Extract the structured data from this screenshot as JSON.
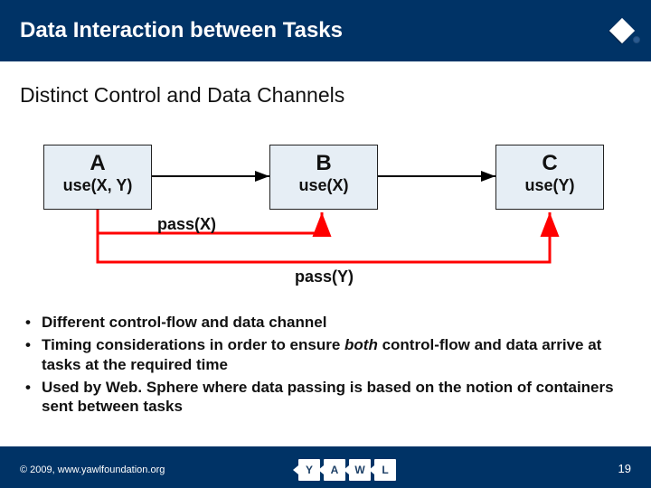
{
  "colors": {
    "brand": "#003366",
    "task_fill": "#e6eef5",
    "pass_stroke": "#ff0000"
  },
  "title": "Data Interaction between Tasks",
  "subtitle": "Distinct Control and Data Channels",
  "diagram": {
    "tasks": [
      {
        "name": "A",
        "use": "use(X, Y)"
      },
      {
        "name": "B",
        "use": "use(X)"
      },
      {
        "name": "C",
        "use": "use(Y)"
      }
    ],
    "edges": [
      {
        "label": "pass(X)"
      },
      {
        "label": "pass(Y)"
      }
    ]
  },
  "bullets": [
    {
      "text_before": "Different control-flow and data channel",
      "emph": "",
      "text_after": ""
    },
    {
      "text_before": "Timing considerations in order to ensure ",
      "emph": "both",
      "text_after": " control-flow and data arrive at tasks at the required time"
    },
    {
      "text_before": "Used by Web. Sphere where data passing is based on the notion of containers sent between tasks",
      "emph": "",
      "text_after": ""
    }
  ],
  "footer": {
    "copyright": "© 2009, www.yawlfoundation.org",
    "slide_number": "19",
    "logo_letters": [
      "Y",
      "A",
      "W",
      "L"
    ]
  }
}
